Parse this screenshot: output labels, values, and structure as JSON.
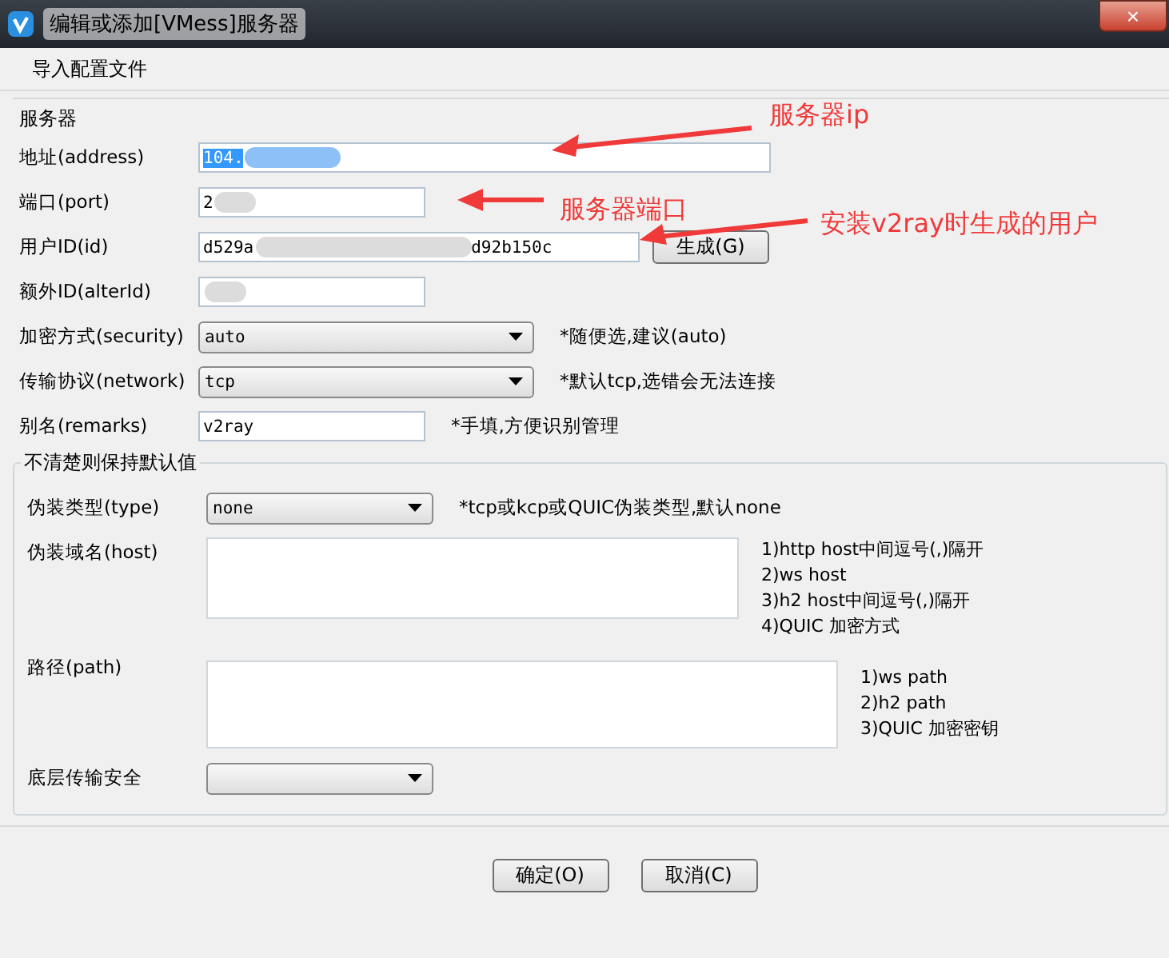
{
  "window": {
    "title": "编辑或添加[VMess]服务器",
    "close": "×"
  },
  "menu": [
    {
      "label": "导入配置文件"
    }
  ],
  "server_group": {
    "title": "服务器",
    "rows": [
      {
        "kind": "text",
        "label": "地址(address)",
        "value": "104.",
        "value_selected": true,
        "redacted": true
      },
      {
        "kind": "text",
        "label": "端口(port)",
        "value": "2",
        "value_selected": false,
        "redacted": true
      },
      {
        "kind": "id",
        "label": "用户ID(id)",
        "value_start": "d529a",
        "value_end": "d92b150c",
        "value_selected": false,
        "redacted": true,
        "button": "生成(G)"
      },
      {
        "kind": "text",
        "label": "额外ID(alterId)",
        "value": "",
        "value_selected": false,
        "redacted": true
      },
      {
        "kind": "select",
        "label": "加密方式(security)",
        "value": "auto",
        "hint": "*随便选,建议(auto)"
      },
      {
        "kind": "select",
        "label": "传输协议(network)",
        "value": "tcp",
        "hint": "*默认tcp,选错会无法连接"
      },
      {
        "kind": "text",
        "label": "别名(remarks)",
        "value": "v2ray",
        "value_selected": false,
        "redacted": false,
        "hint": "*手填,方便识别管理"
      }
    ]
  },
  "default_group": {
    "title": "不清楚则保持默认值",
    "rows": [
      {
        "kind": "select",
        "label": "伪装类型(type)",
        "value": "none",
        "hint": "*tcp或kcp或QUIC伪装类型,默认none"
      },
      {
        "kind": "textarea",
        "label": "伪装域名(host)",
        "hints": [
          "1)http host中间逗号(,)隔开",
          "2)ws host",
          "3)h2 host中间逗号(,)隔开",
          "4)QUIC 加密方式"
        ]
      },
      {
        "kind": "textarea",
        "label": "路径(path)",
        "hints": [
          "1)ws path",
          "2)h2 path",
          "3)QUIC 加密密钥"
        ]
      },
      {
        "kind": "select",
        "label": "底层传输安全"
      }
    ]
  },
  "buttons": [
    {
      "label": "确定(O)"
    },
    {
      "label": "取消(C)"
    }
  ],
  "annotations": [
    {
      "text": "服务器ip"
    },
    {
      "text": "服务器端口"
    },
    {
      "text": "安装v2ray时生成的用户"
    }
  ]
}
